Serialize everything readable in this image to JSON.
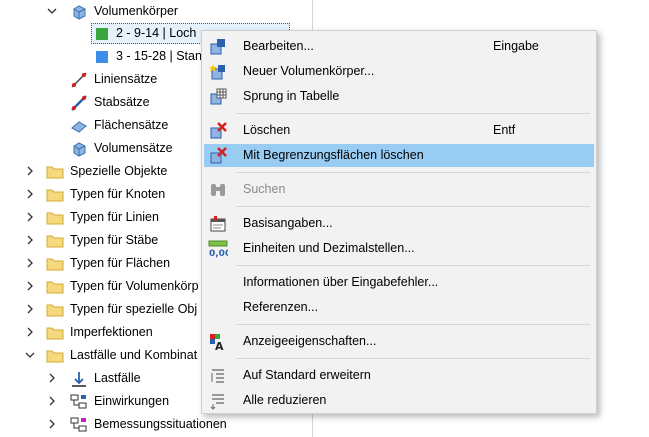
{
  "tree": {
    "items": [
      {
        "label": "Volumenkörper",
        "icon": "solid-cube-icon"
      },
      {
        "label": "2 - 9-14 | Loch",
        "icon": "green-swatch",
        "color": "#3aa53a"
      },
      {
        "label": "3 - 15-28 | Stan",
        "icon": "blue-swatch",
        "color": "#3d8ee8"
      },
      {
        "label": "Liniensätze",
        "icon": "line-set-icon"
      },
      {
        "label": "Stabsätze",
        "icon": "member-set-icon"
      },
      {
        "label": "Flächensätze",
        "icon": "surface-set-icon"
      },
      {
        "label": "Volumensätze",
        "icon": "solid-set-icon"
      },
      {
        "label": "Spezielle Objekte",
        "icon": "folder-icon"
      },
      {
        "label": "Typen für Knoten",
        "icon": "folder-icon"
      },
      {
        "label": "Typen für Linien",
        "icon": "folder-icon"
      },
      {
        "label": "Typen für Stäbe",
        "icon": "folder-icon"
      },
      {
        "label": "Typen für Flächen",
        "icon": "folder-icon"
      },
      {
        "label": "Typen für Volumenkörp",
        "icon": "folder-icon"
      },
      {
        "label": "Typen für spezielle Obj",
        "icon": "folder-icon"
      },
      {
        "label": "Imperfektionen",
        "icon": "folder-icon"
      },
      {
        "label": "Lastfälle und Kombinat",
        "icon": "folder-icon"
      },
      {
        "label": "Lastfälle",
        "icon": "load-case-icon"
      },
      {
        "label": "Einwirkungen",
        "icon": "action-icon"
      },
      {
        "label": "Bemessungssituationen",
        "icon": "design-situation-icon"
      }
    ]
  },
  "context_menu": {
    "items": [
      {
        "label": "Bearbeiten...",
        "shortcut": "Eingabe",
        "icon": "edit-icon"
      },
      {
        "label": "Neuer Volumenkörper...",
        "shortcut": "",
        "icon": "new-solid-icon"
      },
      {
        "label": "Sprung in Tabelle",
        "shortcut": "",
        "icon": "table-jump-icon"
      },
      {
        "label": "Löschen",
        "shortcut": "Entf",
        "icon": "delete-icon"
      },
      {
        "label": "Mit Begrenzungsflächen löschen",
        "shortcut": "",
        "icon": "delete-with-surfaces-icon",
        "highlighted": true
      },
      {
        "label": "Suchen",
        "shortcut": "",
        "icon": "binoculars-icon",
        "disabled": true
      },
      {
        "label": "Basisangaben...",
        "shortcut": "",
        "icon": "base-data-icon"
      },
      {
        "label": "Einheiten und Dezimalstellen...",
        "shortcut": "",
        "icon": "units-icon"
      },
      {
        "label": "Informationen über Eingabefehler...",
        "shortcut": "",
        "icon": ""
      },
      {
        "label": "Referenzen...",
        "shortcut": "",
        "icon": ""
      },
      {
        "label": "Anzeigeeigenschaften...",
        "shortcut": "",
        "icon": "display-properties-icon"
      },
      {
        "label": "Auf Standard erweitern",
        "shortcut": "",
        "icon": "expand-default-icon"
      },
      {
        "label": "Alle reduzieren",
        "shortcut": "",
        "icon": "collapse-all-icon"
      }
    ]
  },
  "colors": {
    "highlight": "#99ccf3",
    "menu_bg": "#f2f2f2",
    "folder": "#f6d97e",
    "delete_red": "#d42020"
  }
}
